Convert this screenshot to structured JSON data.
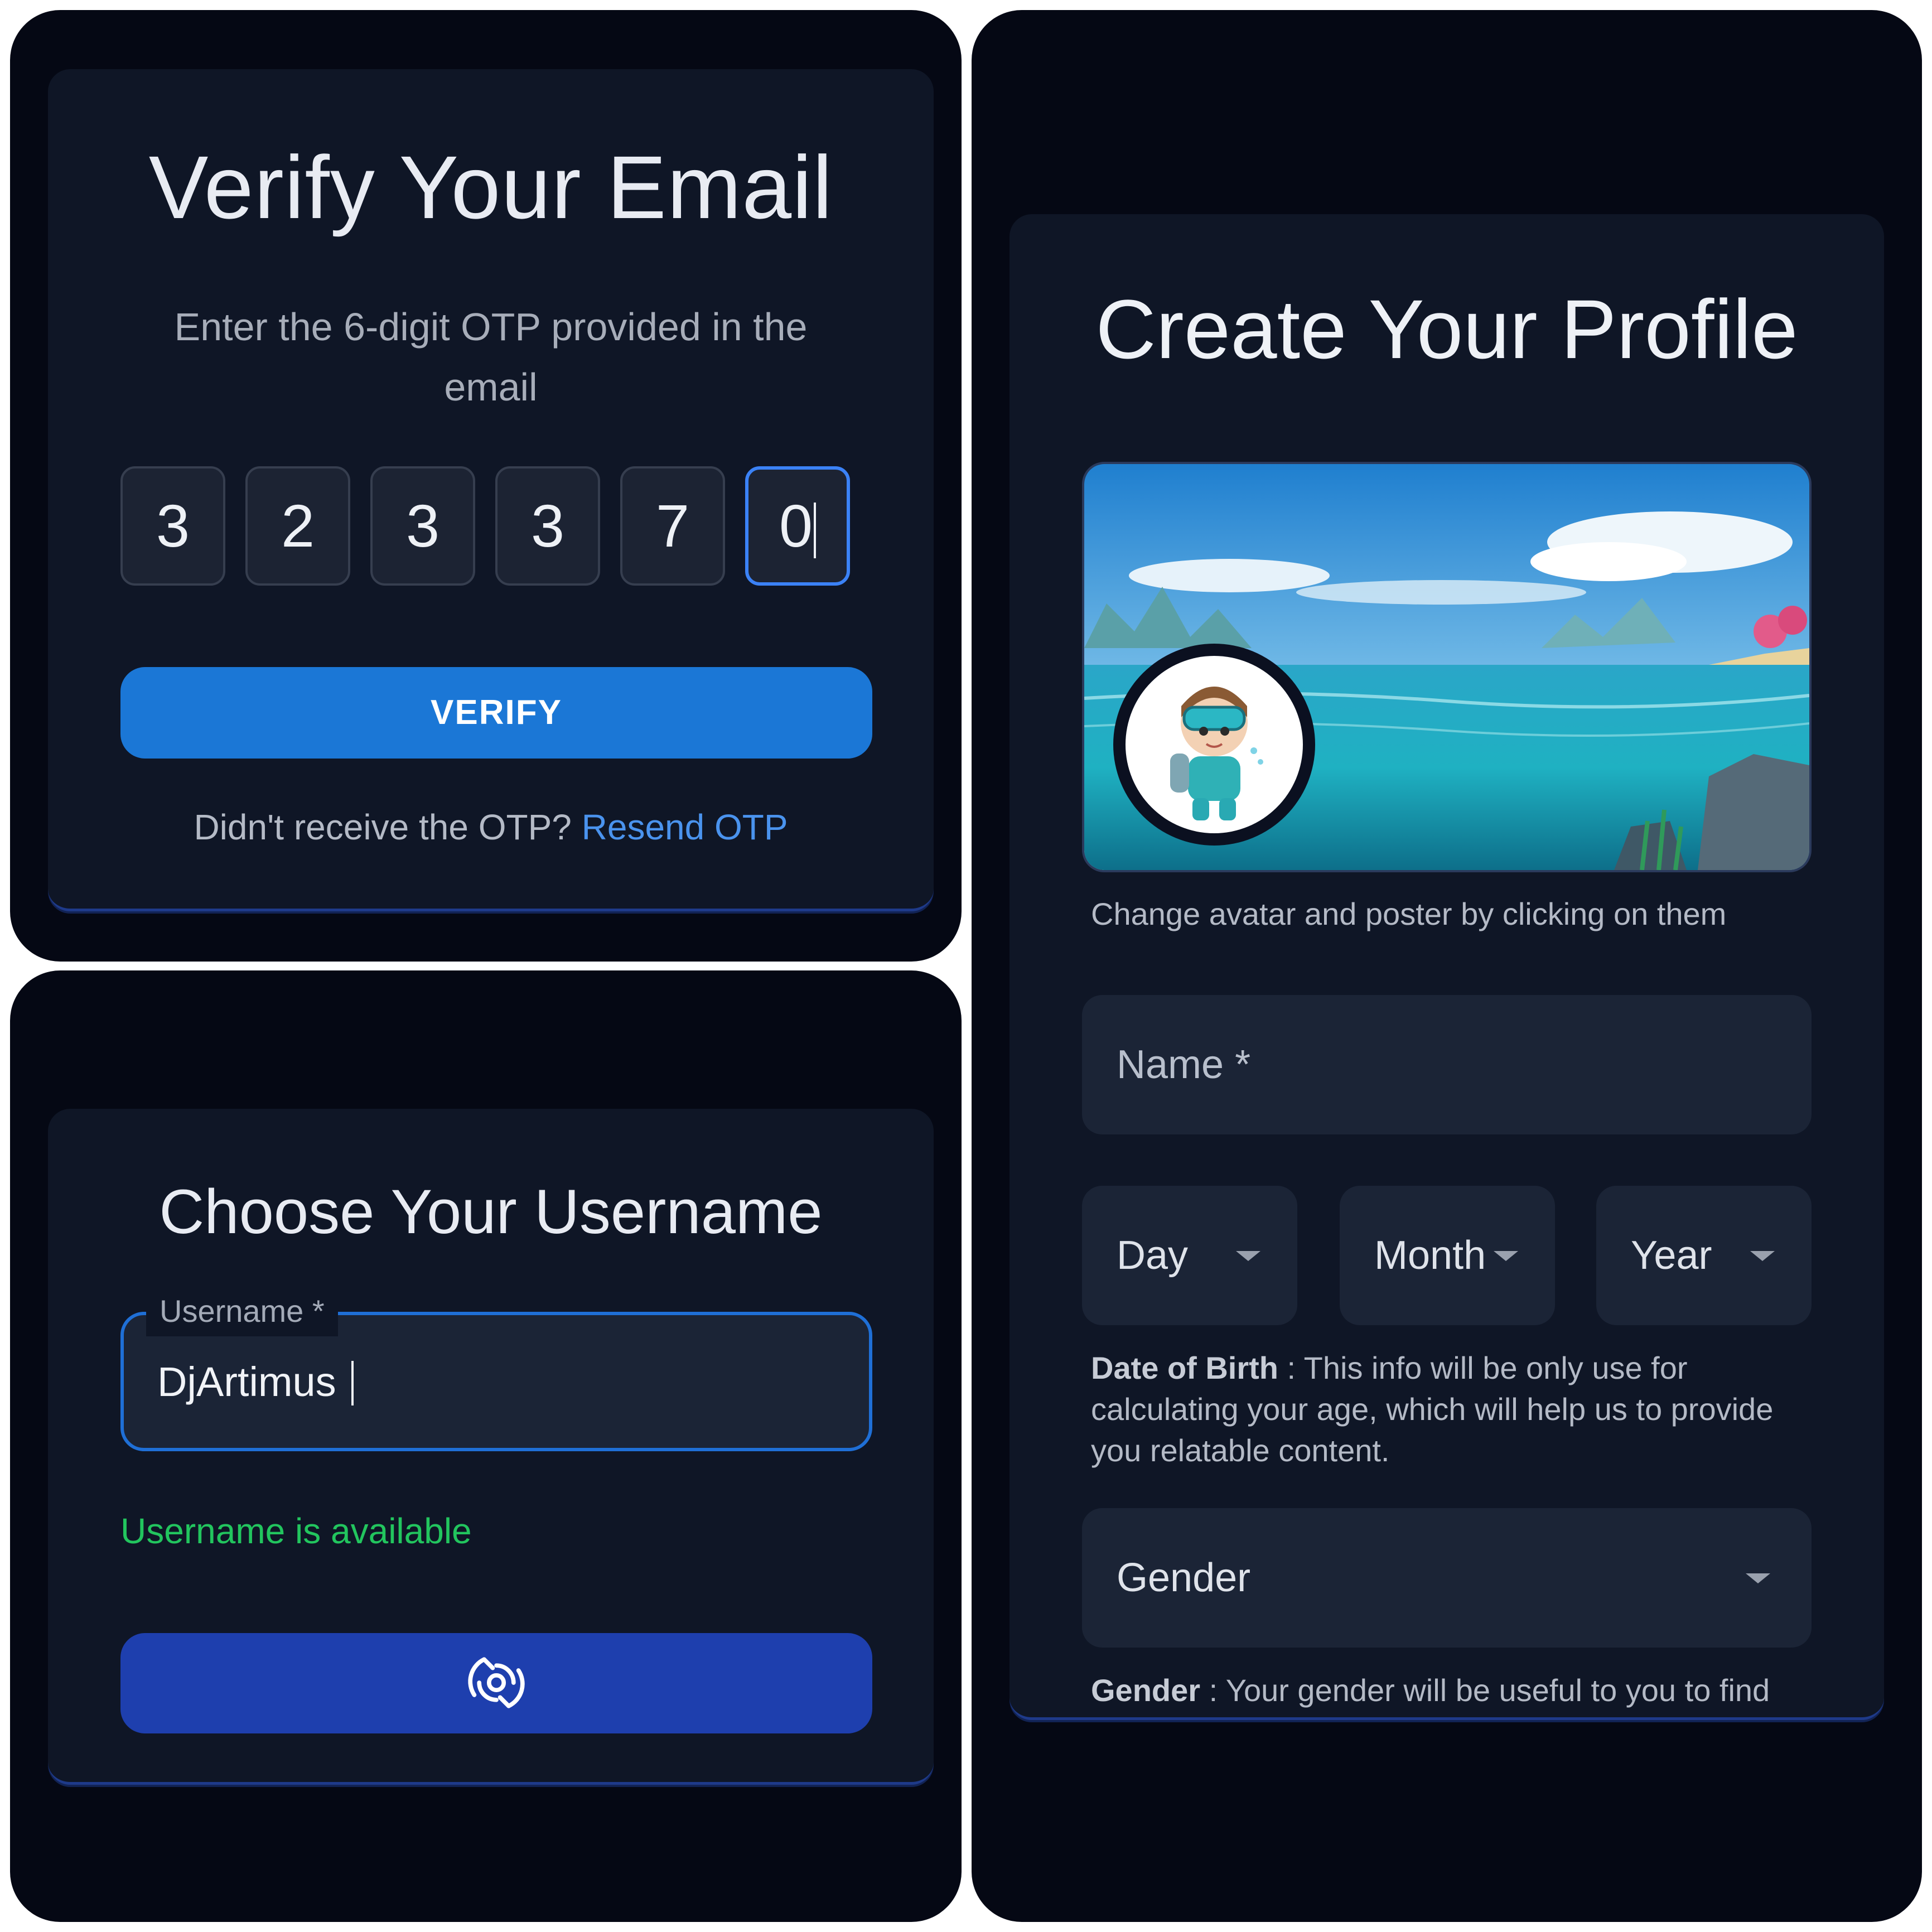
{
  "verify_email": {
    "title": "Verify Your Email",
    "subtitle": "Enter the 6-digit OTP provided in the email",
    "otp_digits": [
      "3",
      "2",
      "3",
      "3",
      "7",
      "0"
    ],
    "verify_button": "VERIFY",
    "resend_prompt": "Didn't receive the OTP?",
    "resend_link": "Resend OTP"
  },
  "username": {
    "title": "Choose Your Username",
    "field_label": "Username *",
    "field_value": "DjArtimus",
    "status": "Username is available",
    "submit_icon": "loading-spinner-icon"
  },
  "profile": {
    "title": "Create Your Profile",
    "poster_hint": "Change avatar and poster by clicking on them",
    "name_placeholder": "Name *",
    "dob": {
      "day": "Day",
      "month": "Month",
      "year": "Year",
      "note_label": "Date of Birth",
      "note_text": " : This info will be only use for calculating your age, which will help us to provide you relatable content."
    },
    "gender": {
      "placeholder": "Gender",
      "note_label": "Gender",
      "note_text": " : Your gender will be useful to you to find and connect others"
    }
  },
  "colors": {
    "accent": "#1b77d6",
    "submit": "#1e3fae",
    "success": "#22c55e",
    "link": "#4a93ee",
    "background": "#050814",
    "card": "#0f1626"
  }
}
